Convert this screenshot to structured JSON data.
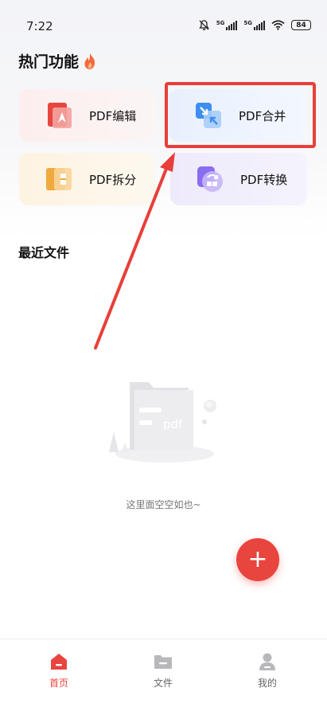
{
  "status": {
    "time": "7:22",
    "sim1": "5G",
    "sim2": "5G",
    "battery": "84"
  },
  "features": {
    "title": "热门功能",
    "title_icon": "fire-icon",
    "items": [
      {
        "label": "PDF编辑",
        "icon": "pdf-edit-icon",
        "color": "#e8453f"
      },
      {
        "label": "PDF合并",
        "icon": "pdf-merge-icon",
        "color": "#3d8ef0"
      },
      {
        "label": "PDF拆分",
        "icon": "pdf-split-icon",
        "color": "#f0a93d"
      },
      {
        "label": "PDF转换",
        "icon": "pdf-convert-icon",
        "color": "#8a6df0"
      }
    ]
  },
  "recent": {
    "title": "最近文件",
    "empty_text": "这里面空空如也~",
    "illustration_text": "pdf"
  },
  "fab": {
    "label": "+"
  },
  "tabbar": {
    "items": [
      {
        "label": "首页",
        "icon": "home-icon",
        "active": true
      },
      {
        "label": "文件",
        "icon": "folder-icon",
        "active": false
      },
      {
        "label": "我的",
        "icon": "profile-icon",
        "active": false
      }
    ]
  },
  "colors": {
    "accent": "#e8453f",
    "highlight": "#e83f3a"
  }
}
